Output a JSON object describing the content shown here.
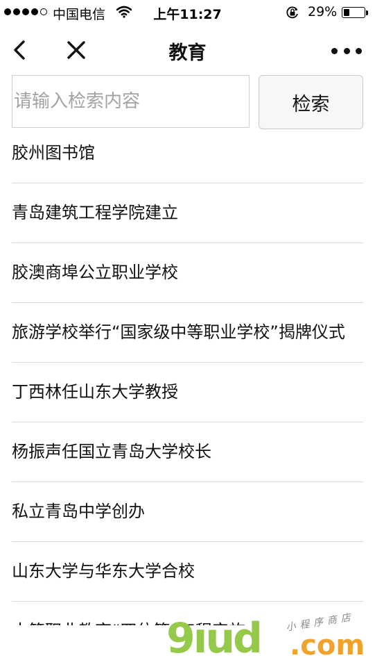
{
  "status_bar": {
    "carrier": "中国电信",
    "time": "上午11:27",
    "battery_percent": "29%",
    "battery_level": 0.29,
    "icons": [
      "signal-dots-icon",
      "wifi-icon",
      "orientation-lock-icon",
      "battery-icon"
    ]
  },
  "nav": {
    "title": "教育",
    "icons": [
      "back-arrow-icon",
      "close-icon",
      "more-dots-icon"
    ]
  },
  "search": {
    "placeholder": "请输入检索内容",
    "value": "",
    "button_label": "检索"
  },
  "results": [
    "胶州图书馆",
    "青岛建筑工程学院建立",
    "胶澳商埠公立职业学校",
    "旅游学校举行“国家级中等职业学校”揭牌仪式",
    "丁西林任山东大学教授",
    "杨振声任国立青岛大学校长",
    "私立青岛中学创办",
    "山东大学与华东大学合校",
    "古籍职业教育“四位等”工程实施"
  ],
  "watermark": {
    "logo": "9ıud",
    "suffix": ".com",
    "tagline": "小程序商店"
  },
  "colors": {
    "background": "#ffffff",
    "divider": "#dcdcdc",
    "placeholder": "#a3a3a3",
    "button_bg": "#f7f7f7",
    "watermark_green": "#95c94a",
    "watermark_orange": "#f1a22b"
  }
}
